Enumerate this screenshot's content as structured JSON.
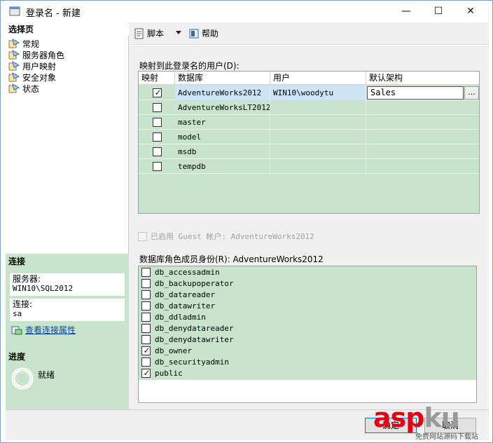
{
  "window": {
    "title": "登录名 - 新建",
    "controls": {
      "minimize": "—",
      "maximize": "☐",
      "close": "✕"
    }
  },
  "left_panel": {
    "pages_header": "选择页",
    "pages": [
      {
        "label": "常规",
        "icon": "page-icon"
      },
      {
        "label": "服务器角色",
        "icon": "page-icon"
      },
      {
        "label": "用户映射",
        "icon": "page-icon"
      },
      {
        "label": "安全对象",
        "icon": "page-icon"
      },
      {
        "label": "状态",
        "icon": "page-icon"
      }
    ],
    "connection_header": "连接",
    "server_label": "服务器:",
    "server_value": "WIN10\\SQL2012",
    "connection_label": "连接:",
    "connection_value": "sa",
    "view_properties_link": "查看连接属性",
    "progress_header": "进度",
    "progress_status": "就绪"
  },
  "toolbar": {
    "script_label": "脚本",
    "help_label": "帮助"
  },
  "mapping": {
    "label": "映射到此登录名的用户(D):",
    "columns": [
      "映射",
      "数据库",
      "用户",
      "默认架构"
    ],
    "rows": [
      {
        "mapped": true,
        "database": "AdventureWorks2012",
        "user": "WIN10\\woodytu",
        "schema": "Sales"
      },
      {
        "mapped": false,
        "database": "AdventureWorksLT2012",
        "user": "",
        "schema": ""
      },
      {
        "mapped": false,
        "database": "master",
        "user": "",
        "schema": ""
      },
      {
        "mapped": false,
        "database": "model",
        "user": "",
        "schema": ""
      },
      {
        "mapped": false,
        "database": "msdb",
        "user": "",
        "schema": ""
      },
      {
        "mapped": false,
        "database": "tempdb",
        "user": "",
        "schema": ""
      }
    ],
    "ellipsis": "..."
  },
  "guest": {
    "label": "已启用 Guest 帐户: AdventureWorks2012",
    "checked": false
  },
  "roles": {
    "label": "数据库角色成员身份(R): AdventureWorks2012",
    "items": [
      {
        "name": "db_accessadmin",
        "checked": false
      },
      {
        "name": "db_backupoperator",
        "checked": false
      },
      {
        "name": "db_datareader",
        "checked": false
      },
      {
        "name": "db_datawriter",
        "checked": false
      },
      {
        "name": "db_ddladmin",
        "checked": false
      },
      {
        "name": "db_denydatareader",
        "checked": false
      },
      {
        "name": "db_denydatawriter",
        "checked": false
      },
      {
        "name": "db_owner",
        "checked": true
      },
      {
        "name": "db_securityadmin",
        "checked": false
      },
      {
        "name": "public",
        "checked": true
      }
    ]
  },
  "buttons": {
    "ok": "确定",
    "cancel": "取消"
  },
  "watermark": {
    "logo_a": "asp",
    "logo_b": "ku",
    "subtitle": "免费网站源码下载站"
  },
  "colors": {
    "accent_green": "#c9e4cc",
    "selection_blue": "#cde4f7",
    "link_blue": "#0645ad"
  }
}
